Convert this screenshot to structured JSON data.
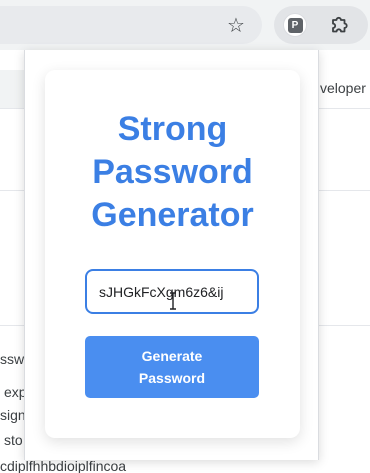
{
  "toolbar": {
    "star_icon": "star-outline-icon",
    "extension_badge": "P",
    "puzzle_icon": "puzzle-icon"
  },
  "background_page": {
    "right_text": "veloper",
    "left_fragments": [
      "ssw",
      "exp",
      "sign",
      "sto"
    ],
    "bottom_text": "cdiplfhhbdioiplfincoa"
  },
  "popup": {
    "title_line1": "Strong",
    "title_line2": "Password",
    "title_line3": "Generator",
    "password_value": "sJHGkFcXgm6z6&ij",
    "button_line1": "Generate",
    "button_line2": "Password"
  },
  "colors": {
    "accent": "#3b7fe4",
    "button": "#4a8ef0"
  }
}
